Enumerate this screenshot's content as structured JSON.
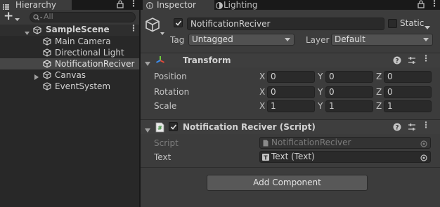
{
  "hierarchy": {
    "tab_label": "Hierarchy",
    "search_placeholder": "All",
    "scene": "SampleScene",
    "items": [
      {
        "label": "Main Camera"
      },
      {
        "label": "Directional Light"
      },
      {
        "label": "NotificationReciver"
      },
      {
        "label": "Canvas"
      },
      {
        "label": "EventSystem"
      }
    ]
  },
  "inspector": {
    "tab_label": "Inspector",
    "lighting_tab_label": "Lighting",
    "object_name": "NotificationReciver",
    "static_label": "Static",
    "tag_label": "Tag",
    "tag_value": "Untagged",
    "layer_label": "Layer",
    "layer_value": "Default",
    "transform": {
      "title": "Transform",
      "rows": [
        {
          "label": "Position",
          "x": "0",
          "y": "0",
          "z": "0"
        },
        {
          "label": "Rotation",
          "x": "0",
          "y": "0",
          "z": "0"
        },
        {
          "label": "Scale",
          "x": "1",
          "y": "1",
          "z": "1"
        }
      ],
      "axis_x": "X",
      "axis_y": "Y",
      "axis_z": "Z"
    },
    "script_component": {
      "title": "Notification Reciver (Script)",
      "script_label": "Script",
      "script_value": "NotificationReciver",
      "text_label": "Text",
      "text_value": "Text (Text)"
    },
    "add_component_label": "Add Component"
  },
  "colors": {
    "selection": "#2c5d87",
    "panel": "#383838",
    "field": "#2a2a2a"
  }
}
